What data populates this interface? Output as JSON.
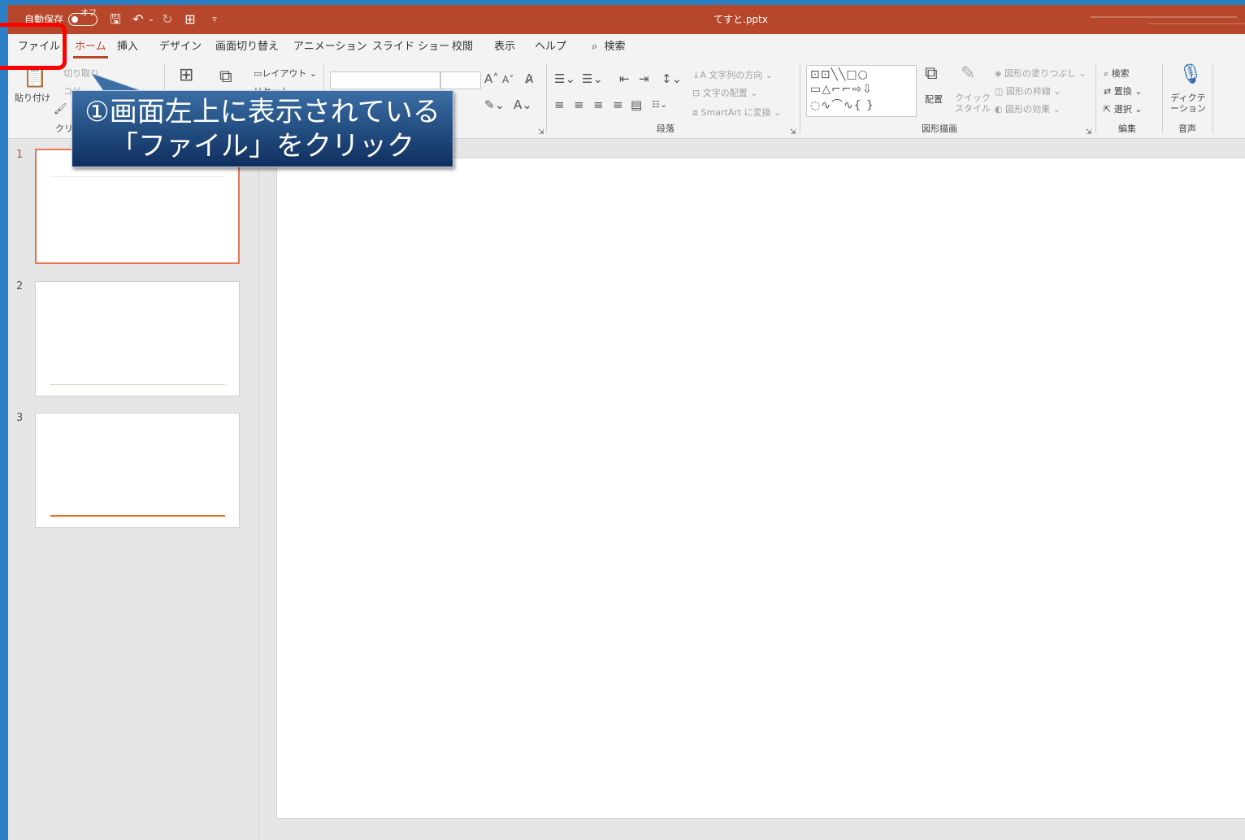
{
  "titlebar": {
    "autosave_label": "自動保存",
    "autosave_state": "オフ",
    "filename": "てすと.pptx"
  },
  "menu": {
    "tabs": [
      "ファイル",
      "ホーム",
      "挿入",
      "デザイン",
      "画面切り替え",
      "アニメーション",
      "スライド ショー",
      "校閲",
      "表示",
      "ヘルプ"
    ],
    "search_label": "検索",
    "active_tab": "ホーム"
  },
  "ribbon": {
    "clipboard": {
      "paste": "貼り付け",
      "cut": "切り取り",
      "copy": "コピー",
      "group_label": "クリップボード"
    },
    "slides": {
      "layout": "レイアウト",
      "reset": "リセット"
    },
    "paragraph": {
      "text_direction": "文字列の方向",
      "align_text": "文字の配置",
      "smartart": "SmartArt に変換",
      "group_label": "段落"
    },
    "drawing": {
      "arrange": "配置",
      "quick_styles": "クイック スタイル",
      "fill": "図形の塗りつぶし",
      "outline": "図形の枠線",
      "effects": "図形の効果",
      "group_label": "図形描画"
    },
    "editing": {
      "find": "検索",
      "replace": "置換",
      "select": "選択",
      "group_label": "編集"
    },
    "voice": {
      "dictate": "ディクテーション",
      "group_label": "音声"
    }
  },
  "slides": {
    "numbers": [
      "1",
      "2",
      "3"
    ],
    "selected": "1"
  },
  "callout": {
    "line1": "①画面左上に表示されている",
    "line2": "「ファイル」をクリック"
  },
  "colors": {
    "accent": "#b7472a",
    "highlight": "#ff0000",
    "callout_bg": "#1f4e8c"
  }
}
